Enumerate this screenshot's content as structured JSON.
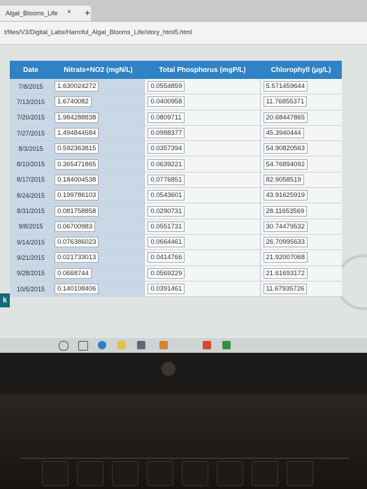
{
  "browser": {
    "tab_title": "Algal_Blooms_Life",
    "tab_close": "×",
    "new_tab": "+",
    "url": "t/files/V3/Digital_Labs/Harmful_Algal_Blooms_Life/story_html5.html"
  },
  "table": {
    "headers": [
      "Date",
      "Nitrate+NO2 (mgN/L)",
      "Total Phosphorus (mgP/L)",
      "Chlorophyll (µg/L)"
    ],
    "rows": [
      [
        "7/8/2015",
        "1.630024272",
        "0.0554859",
        "5.571459644"
      ],
      [
        "7/13/2015",
        "1.6740082",
        "0.0400958",
        "11.76855371"
      ],
      [
        "7/20/2015",
        "1.984288838",
        "0.0809711",
        "20.68447865"
      ],
      [
        "7/27/2015",
        "1.494844584",
        "0.0988377",
        "45.3940444"
      ],
      [
        "8/3/2015",
        "0.592363815",
        "0.0357394",
        "54.90820563"
      ],
      [
        "8/10/2015",
        "0.365471865",
        "0.0639221",
        "54.76894092"
      ],
      [
        "8/17/2015",
        "0.184004538",
        "0.0776851",
        "82.9058519"
      ],
      [
        "8/24/2015",
        "0.199786103",
        "0.0543601",
        "43.91625919"
      ],
      [
        "8/31/2015",
        "0.081758858",
        "0.0290731",
        "28.11653569"
      ],
      [
        "9/8/2015",
        "0.06700983",
        "0.0551731",
        "30.74479532"
      ],
      [
        "9/14/2015",
        "0.076386023",
        "0.0664461",
        "26.70995633"
      ],
      [
        "9/21/2015",
        "0.021733013",
        "0.0414766",
        "21.92007068"
      ],
      [
        "9/28/2015",
        "0.0668744",
        "0.0569229",
        "21.61693172"
      ],
      [
        "10/5/2015",
        "0.140108406",
        "0.0391461",
        "11.67935726"
      ]
    ]
  },
  "side_tab": "k",
  "colors": {
    "header": "#2f82c4",
    "date_column": "#c9d7e6",
    "side_tab": "#0f6a75"
  },
  "taskbar_icons": [
    "search-icon",
    "task-view-icon",
    "edge-icon",
    "file-explorer-icon",
    "store-icon",
    "app-icon",
    "office-icon",
    "chrome-icon"
  ]
}
